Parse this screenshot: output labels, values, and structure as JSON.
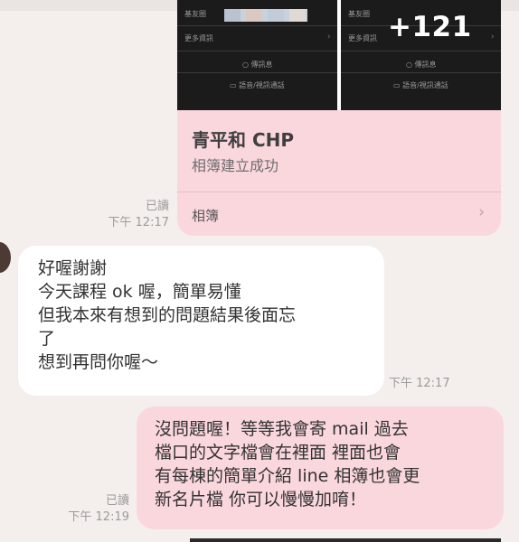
{
  "album": {
    "thumb1": {
      "name_label": "基友圈",
      "more_info": "更多資訊",
      "message": "傳訊息",
      "call": "語音/視訊通話"
    },
    "thumb2": {
      "name_label": "基友圈",
      "more_info": "更多資訊",
      "message": "傳訊息",
      "call": "語音/視訊通話",
      "overlay_count": "+121"
    },
    "title": "青平和 CHP",
    "subtitle": "相簿建立成功",
    "footer_label": "相簿",
    "chevron": "›"
  },
  "meta1": {
    "read": "已讀",
    "time": "下午 12:17"
  },
  "incoming": {
    "lines": [
      "好喔謝謝",
      "今天課程 ok 喔，簡單易懂",
      "但我本來有想到的問題結果後面忘",
      "了",
      "想到再問你喔～"
    ],
    "time": "下午 12:17"
  },
  "outgoing": {
    "lines": [
      "沒問題喔！等等我會寄 mail 過去",
      "檔口的文字檔會在裡面 裡面也會",
      "有每棟的簡單介紹 line 相簿也會更",
      "新名片檔 你可以慢慢加唷！"
    ]
  },
  "meta2": {
    "read": "已讀",
    "time": "下午 12:19"
  },
  "colors": {
    "background": "#f4efec",
    "outgoing_bubble": "#fad7dd",
    "incoming_bubble": "#ffffff",
    "meta_text": "#9b9b9b"
  }
}
